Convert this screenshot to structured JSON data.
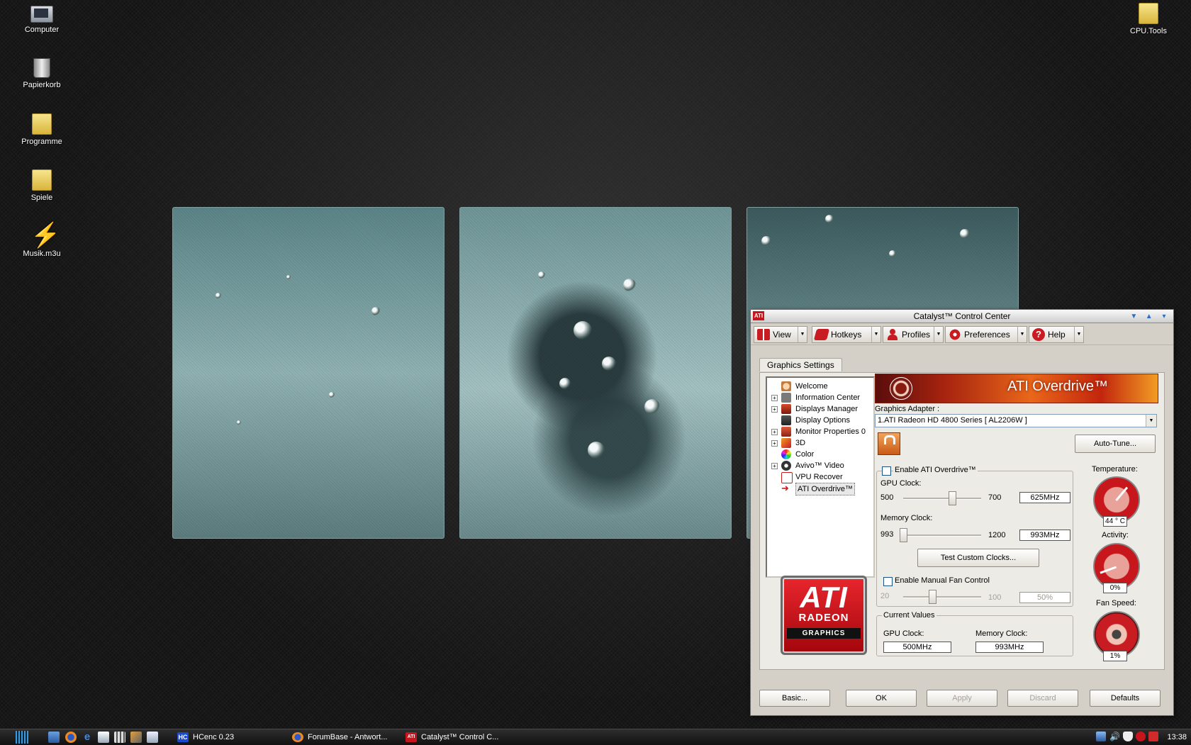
{
  "desktop": {
    "icons": [
      {
        "label": "Computer",
        "icon": "computer-icon"
      },
      {
        "label": "Papierkorb",
        "icon": "recycle-bin-icon"
      },
      {
        "label": "Programme",
        "icon": "folder-icon"
      },
      {
        "label": "Spiele",
        "icon": "folder-icon"
      },
      {
        "label": "Musik.m3u",
        "icon": "playlist-icon"
      },
      {
        "label": "CPU.Tools",
        "icon": "folder-icon"
      }
    ]
  },
  "window": {
    "title": "Catalyst™ Control Center",
    "toolbar": {
      "view": "View",
      "hotkeys": "Hotkeys",
      "profiles": "Profiles",
      "preferences": "Preferences",
      "help": "Help"
    },
    "tab": "Graphics Settings",
    "tree": [
      {
        "label": "Welcome",
        "expandable": false
      },
      {
        "label": "Information Center",
        "expandable": true
      },
      {
        "label": "Displays Manager",
        "expandable": true
      },
      {
        "label": "Display Options",
        "expandable": false
      },
      {
        "label": "Monitor Properties 0",
        "expandable": true
      },
      {
        "label": "3D",
        "expandable": true
      },
      {
        "label": "Color",
        "expandable": false
      },
      {
        "label": "Avivo™ Video",
        "expandable": true
      },
      {
        "label": "VPU Recover",
        "expandable": false
      },
      {
        "label": "ATI Overdrive™",
        "expandable": false,
        "selected": true
      }
    ],
    "logo": {
      "line1": "ATI",
      "line2": "RADEON",
      "line3": "GRAPHICS"
    },
    "overdrive": {
      "banner_title": "ATI Overdrive™",
      "adapter_label": "Graphics Adapter :",
      "adapter_value": "1.ATI Radeon HD 4800 Series  [ AL2206W ]",
      "auto_tune": "Auto-Tune...",
      "enable_label": "Enable ATI Overdrive™",
      "gpu_clock_label": "GPU Clock:",
      "gpu_min": "500",
      "gpu_max": "700",
      "gpu_value": "625MHz",
      "gpu_level": 0.625,
      "mem_clock_label": "Memory Clock:",
      "mem_min": "993",
      "mem_max": "1200",
      "mem_value": "993MHz",
      "mem_level": 0.0,
      "test_clocks": "Test Custom Clocks...",
      "fan_enable_label": "Enable Manual Fan Control",
      "fan_min": "20",
      "fan_max": "100",
      "fan_value": "50%",
      "fan_level": 0.375,
      "current_values_label": "Current Values",
      "cur_gpu_label": "GPU Clock:",
      "cur_gpu_value": "500MHz",
      "cur_mem_label": "Memory Clock:",
      "cur_mem_value": "993MHz",
      "temperature_label": "Temperature:",
      "temperature_value": "44 ° C",
      "activity_label": "Activity:",
      "activity_value": "0%",
      "fan_speed_label": "Fan Speed:",
      "fan_speed_value": "1%"
    },
    "buttons": {
      "basic": "Basic...",
      "ok": "OK",
      "apply": "Apply",
      "discard": "Discard",
      "defaults": "Defaults"
    }
  },
  "taskbar": {
    "tasks": [
      {
        "label": "HCenc 0.23"
      },
      {
        "label": "ForumBase - Antwort..."
      },
      {
        "label": "Catalyst™ Control C..."
      }
    ],
    "clock": "13:38"
  },
  "colors": {
    "ati_red": "#c8141b",
    "window_face": "#d4d0c8",
    "desktop_bg": "#121212"
  }
}
